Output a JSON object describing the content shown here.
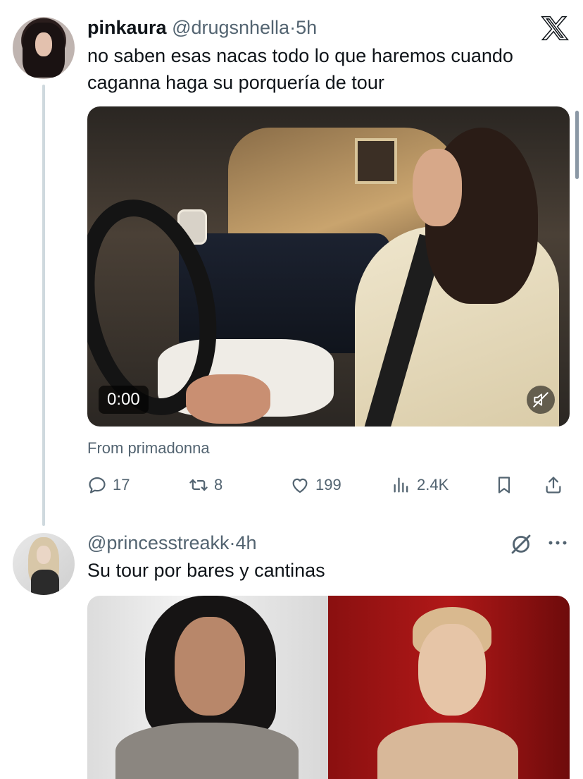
{
  "tweet1": {
    "display_name": "pinkaura",
    "handle": "@drugsnhella",
    "separator": "·",
    "time": "5h",
    "text": "no saben esas nacas todo lo que haremos cuando caganna haga su porquería de tour",
    "video": {
      "timestamp": "0:00",
      "muted": true
    },
    "source_label": "From primadonna",
    "stats": {
      "replies": "17",
      "reposts": "8",
      "likes": "199",
      "views": "2.4K"
    }
  },
  "tweet2": {
    "handle": "@princesstreakk",
    "separator": "·",
    "time": "4h",
    "text": "Su tour por bares y cantinas"
  },
  "icons": {
    "brand": "x-logo-icon",
    "reply": "reply-icon",
    "repost": "repost-icon",
    "like": "heart-icon",
    "views": "views-icon",
    "bookmark": "bookmark-icon",
    "share": "share-icon",
    "mute": "muted-speaker-icon",
    "grok": "grok-icon",
    "more": "more-dots-icon"
  },
  "colors": {
    "text_primary": "#0f1419",
    "text_secondary": "#536471",
    "thread_line": "#cfd9de"
  }
}
